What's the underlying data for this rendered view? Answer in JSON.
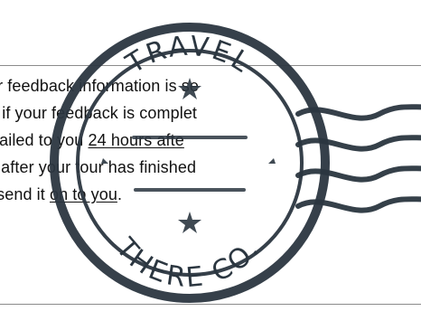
{
  "text_block": {
    "lines": [
      {
        "pre": "h you! Your feedback information is se",
        "underlined": "",
        "post": ""
      },
      {
        "pre": "ere Co trip if your feedback is complet",
        "underlined": "",
        "post": ""
      },
      {
        "pre": "will be e-mailed to you ",
        "underlined": "24 hours afte",
        "post": ""
      },
      {
        "pre": "n the days after your tour has finished",
        "underlined": "",
        "post": ""
      },
      {
        "pre": "nd we will send it ",
        "underlined": "on to you",
        "post": "."
      }
    ]
  },
  "stamp": {
    "top_text": "TRAVEL",
    "bottom_text": "THERE CO."
  },
  "colors": {
    "stamp": "#2b3640",
    "divider": "#8b8b8b",
    "text": "#111111"
  }
}
